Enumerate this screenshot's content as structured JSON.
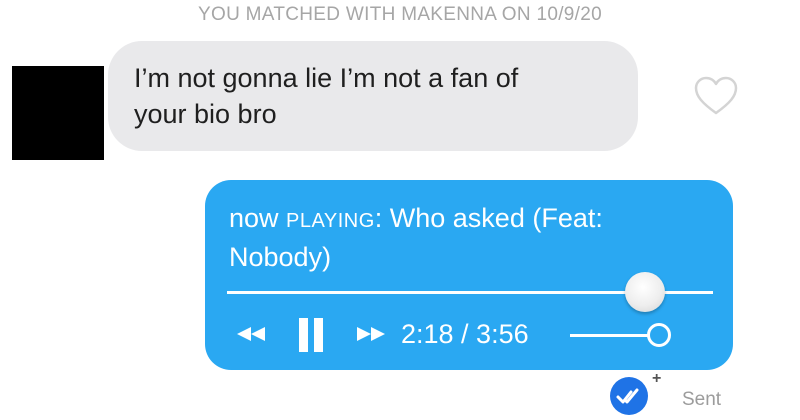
{
  "match_header": "YOU MATCHED WITH MAKENNA ON 10/9/20",
  "incoming_message": {
    "line1": "I’m not gonna lie I’m not a fan of",
    "line2": "your bio bro"
  },
  "outgoing_message": {
    "now_prefix": "now",
    "playing_caps": "PLAYING",
    "title_rest": ": Who asked (Feat:",
    "title_line2": "Nobody)",
    "elapsed": "2:18",
    "separator": "/",
    "duration": "3:56",
    "time_text": "2:18 / 3:56",
    "progress_fraction": 0.86,
    "volume_fraction": 1.0
  },
  "status": {
    "plus": "+",
    "sent_label": "Sent"
  },
  "icons": {
    "like": "heart-outline-icon",
    "rewind": "rewind-icon",
    "pause": "pause-icon",
    "forward": "fast-forward-icon",
    "read_receipt": "double-check-icon"
  },
  "colors": {
    "outgoing_bubble": "#2aa8f2",
    "incoming_bubble": "#e9e9eb",
    "receipt_badge": "#1f73e6"
  }
}
